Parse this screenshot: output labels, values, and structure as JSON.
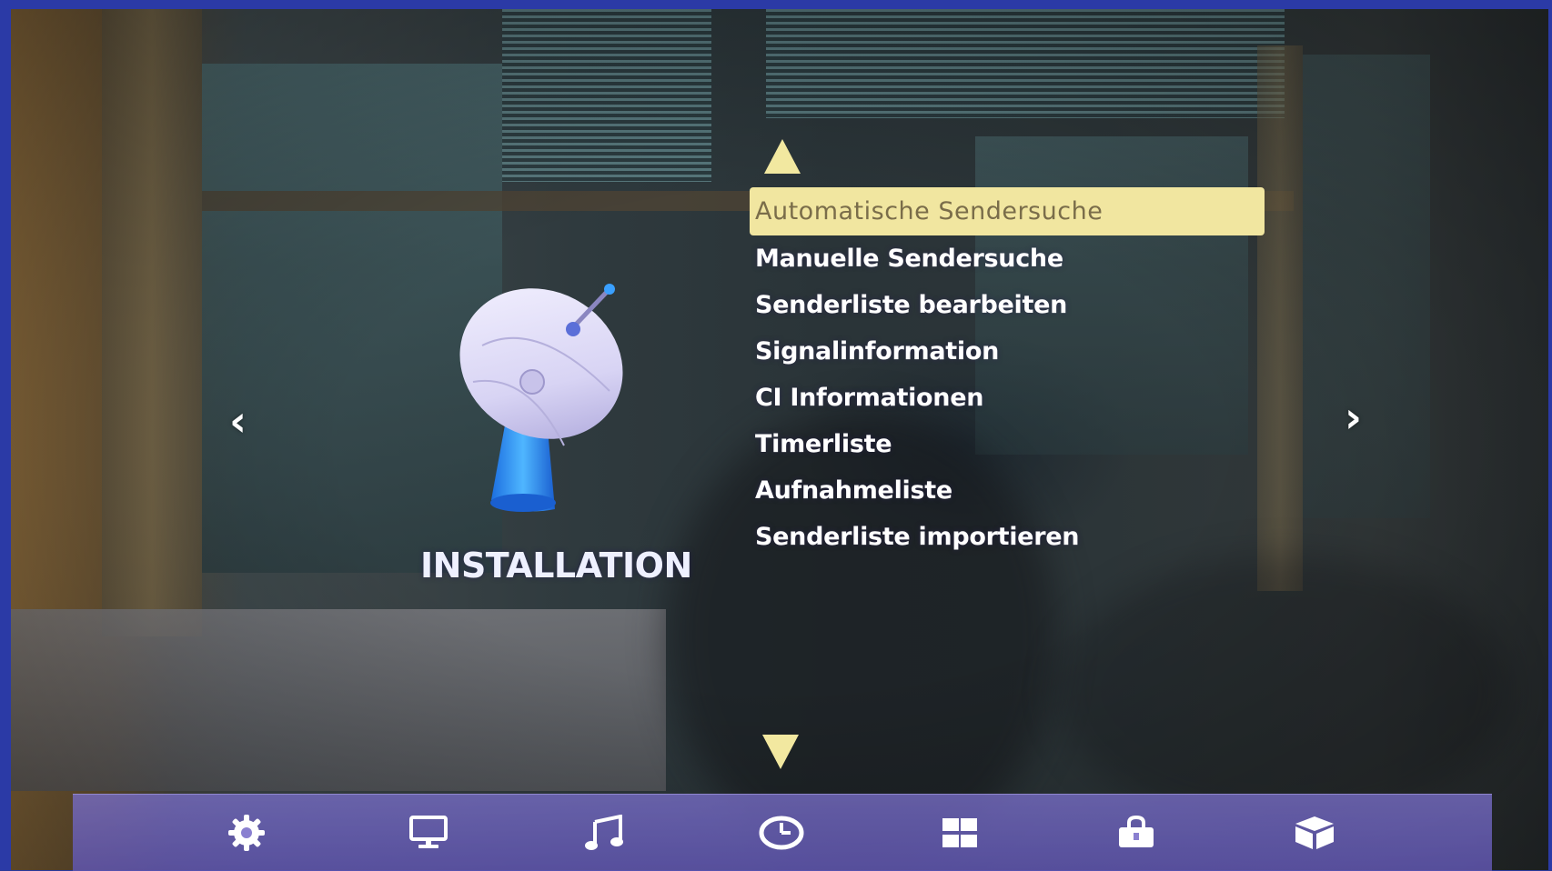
{
  "menu": {
    "title": "INSTALLATION",
    "items": [
      {
        "label": "Automatische Sendersuche",
        "selected": true
      },
      {
        "label": "Manuelle Sendersuche",
        "selected": false
      },
      {
        "label": "Senderliste bearbeiten",
        "selected": false
      },
      {
        "label": "Signalinformation",
        "selected": false
      },
      {
        "label": "CI Informationen",
        "selected": false
      },
      {
        "label": "Timerliste",
        "selected": false
      },
      {
        "label": "Aufnahmeliste",
        "selected": false
      },
      {
        "label": "Senderliste importieren",
        "selected": false
      }
    ],
    "nav_left": "‹",
    "nav_right": "›"
  },
  "bottom_bar": {
    "icons": [
      {
        "name": "settings-gear-icon"
      },
      {
        "name": "monitor-icon"
      },
      {
        "name": "music-note-icon"
      },
      {
        "name": "clock-icon"
      },
      {
        "name": "grid-icon"
      },
      {
        "name": "lock-icon"
      },
      {
        "name": "box-icon"
      }
    ]
  },
  "colors": {
    "highlight": "#f1e6a0",
    "highlight_text": "#7a6d4a",
    "bar": "#7a6fc8",
    "frame": "#2b3aa6"
  }
}
